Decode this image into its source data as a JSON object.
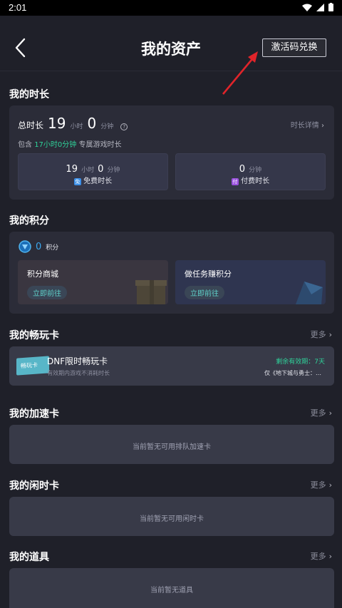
{
  "status_bar": {
    "time": "2:01"
  },
  "header": {
    "title": "我的资产",
    "redeem_label": "激活码兑换"
  },
  "duration": {
    "section_title": "我的时长",
    "total_label": "总时长",
    "hours": "19",
    "hour_unit": "小时",
    "minutes": "0",
    "minute_unit": "分钟",
    "detail_link": "时长详情",
    "include_prefix": "包含",
    "include_highlight": "17小时0分钟",
    "include_suffix": "专属游戏时长",
    "free": {
      "hours": "19",
      "hour_unit": "小时",
      "minutes": "0",
      "minute_unit": "分钟",
      "badge": "免",
      "label": "免费时长"
    },
    "paid": {
      "minutes": "0",
      "minute_unit": "分钟",
      "badge": "付",
      "label": "付费时长"
    }
  },
  "points": {
    "section_title": "我的积分",
    "value": "0",
    "unit": "积分",
    "mall": {
      "title": "积分商城",
      "button": "立即前往"
    },
    "tasks": {
      "title": "做任务赚积分",
      "button": "立即前往"
    }
  },
  "play_card": {
    "section_title": "我的畅玩卡",
    "more": "更多",
    "card_badge": "畅玩卡",
    "name": "DNF限时畅玩卡",
    "desc": "有效期内游戏不消耗时长",
    "validity_label": "剩余有效期：",
    "validity_value": "7天",
    "scope": "仅《地下城与勇士：…"
  },
  "speed_card": {
    "section_title": "我的加速卡",
    "more": "更多",
    "empty": "当前暂无可用排队加速卡"
  },
  "idle_card": {
    "section_title": "我的闲时卡",
    "more": "更多",
    "empty": "当前暂无可用闲时卡"
  },
  "items": {
    "section_title": "我的道具",
    "more": "更多",
    "empty": "当前暂无道具"
  }
}
